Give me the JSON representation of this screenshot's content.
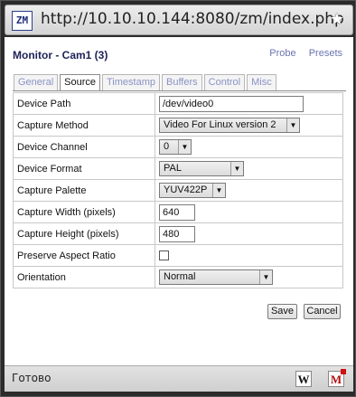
{
  "browser": {
    "url": "http://10.10.10.144:8080/zm/index.php",
    "logo_text": "ZM",
    "bookmark_icon": "star-icon",
    "status_text": "Готово",
    "status_icons": [
      "w-icon",
      "m-icon"
    ]
  },
  "page": {
    "title": "Monitor - Cam1 (3)",
    "links": {
      "probe": "Probe",
      "presets": "Presets"
    }
  },
  "tabs": [
    "General",
    "Source",
    "Timestamp",
    "Buffers",
    "Control",
    "Misc"
  ],
  "active_tab": "Source",
  "fields": {
    "device_path": {
      "label": "Device Path",
      "value": "/dev/video0"
    },
    "capture_method": {
      "label": "Capture Method",
      "value": "Video For Linux version 2"
    },
    "device_channel": {
      "label": "Device Channel",
      "value": "0"
    },
    "device_format": {
      "label": "Device Format",
      "value": "PAL"
    },
    "capture_palette": {
      "label": "Capture Palette",
      "value": "YUV422P"
    },
    "capture_width": {
      "label": "Capture Width (pixels)",
      "value": "640"
    },
    "capture_height": {
      "label": "Capture Height (pixels)",
      "value": "480"
    },
    "preserve_aspect": {
      "label": "Preserve Aspect Ratio",
      "checked": false
    },
    "orientation": {
      "label": "Orientation",
      "value": "Normal"
    }
  },
  "buttons": {
    "save": "Save",
    "cancel": "Cancel"
  },
  "colors": {
    "heading": "#1d2157",
    "link": "#6a74b0",
    "tab_inactive": "#8a92c4"
  }
}
